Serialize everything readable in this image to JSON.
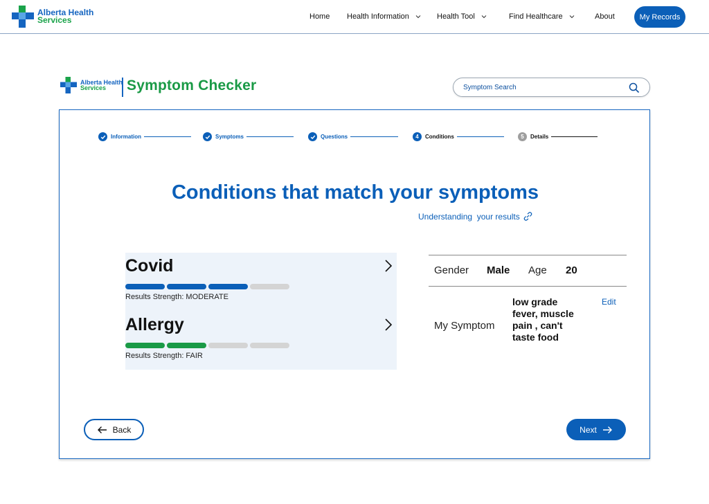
{
  "brand": {
    "name_line1": "Alberta Health",
    "name_line2": "Services"
  },
  "nav": {
    "items": [
      {
        "label": "Home",
        "dropdown": false
      },
      {
        "label": "Health Information",
        "dropdown": true
      },
      {
        "label": "Health Tool",
        "dropdown": true
      },
      {
        "label": "Find Healthcare",
        "dropdown": true
      },
      {
        "label": "About",
        "dropdown": false
      }
    ],
    "records_button": "My Records"
  },
  "header": {
    "title": "Symptom Checker",
    "search_placeholder": "Symptom Search"
  },
  "stepper": [
    {
      "label": "Information",
      "state": "done",
      "number": ""
    },
    {
      "label": "Symptoms",
      "state": "done",
      "number": ""
    },
    {
      "label": "Questions",
      "state": "done",
      "number": ""
    },
    {
      "label": "Conditions",
      "state": "current",
      "number": "4"
    },
    {
      "label": "Details",
      "state": "pending",
      "number": "5"
    }
  ],
  "main": {
    "title": "Conditions that match your symptoms",
    "understanding_link": "Understanding  your results"
  },
  "conditions": [
    {
      "name": "Covid",
      "strength_text": "Results Strength: MODERATE",
      "filled_segments": 3,
      "total_segments": 4,
      "color": "#0b5fb8"
    },
    {
      "name": "Allergy",
      "strength_text": "Results Strength: FAIR",
      "filled_segments": 2,
      "total_segments": 4,
      "color": "#1a9a46"
    }
  ],
  "profile": {
    "gender_label": "Gender",
    "gender_value": "Male",
    "age_label": "Age",
    "age_value": "20",
    "symptom_label": "My Symptom",
    "symptom_value": "low grade fever, muscle pain , can't taste food",
    "edit_label": "Edit"
  },
  "actions": {
    "back_label": "Back",
    "next_label": "Next"
  },
  "colors": {
    "primary": "#0b5fb8",
    "brand_green": "#1a9a46",
    "panel_bg": "#edf3fa",
    "pending_gray": "#9e9e9e"
  }
}
